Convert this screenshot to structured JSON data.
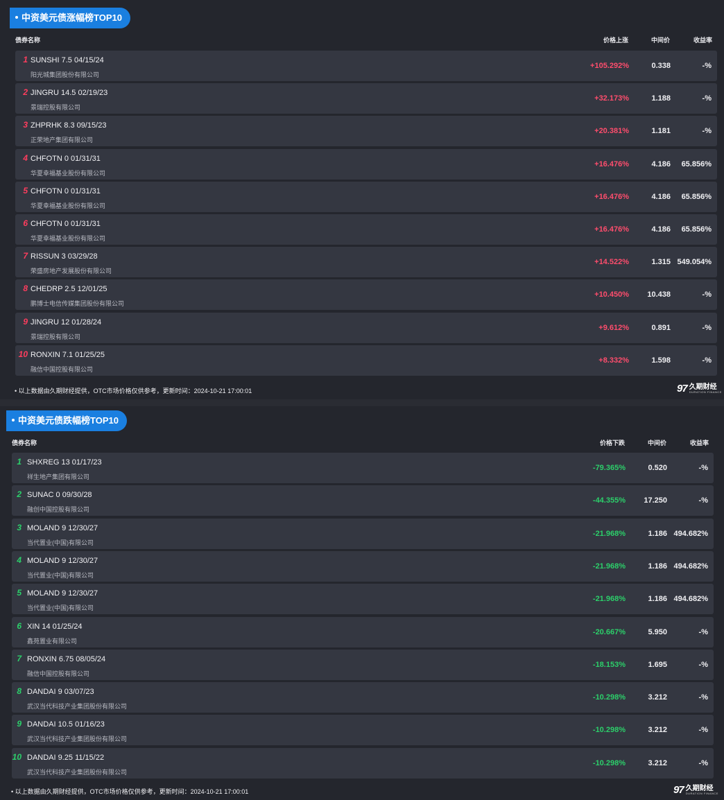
{
  "gainers": {
    "title": "中资美元债涨幅榜TOP10",
    "headers": {
      "name": "债券名称",
      "change": "价格上涨",
      "mid": "中间价",
      "yield": "收益率"
    },
    "rows": [
      {
        "rank": "1",
        "name": "SUNSHI 7.5 04/15/24",
        "issuer": "阳光城集团股份有限公司",
        "change": "+105.292%",
        "mid": "0.338",
        "yield": "-%"
      },
      {
        "rank": "2",
        "name": "JINGRU 14.5 02/19/23",
        "issuer": "景瑞控股有限公司",
        "change": "+32.173%",
        "mid": "1.188",
        "yield": "-%"
      },
      {
        "rank": "3",
        "name": "ZHPRHK 8.3 09/15/23",
        "issuer": "正荣地产集团有限公司",
        "change": "+20.381%",
        "mid": "1.181",
        "yield": "-%"
      },
      {
        "rank": "4",
        "name": "CHFOTN 0 01/31/31",
        "issuer": "华夏幸福基业股份有限公司",
        "change": "+16.476%",
        "mid": "4.186",
        "yield": "65.856%"
      },
      {
        "rank": "5",
        "name": "CHFOTN 0 01/31/31",
        "issuer": "华夏幸福基业股份有限公司",
        "change": "+16.476%",
        "mid": "4.186",
        "yield": "65.856%"
      },
      {
        "rank": "6",
        "name": "CHFOTN 0 01/31/31",
        "issuer": "华夏幸福基业股份有限公司",
        "change": "+16.476%",
        "mid": "4.186",
        "yield": "65.856%"
      },
      {
        "rank": "7",
        "name": "RISSUN 3 03/29/28",
        "issuer": "荣盛房地产发展股份有限公司",
        "change": "+14.522%",
        "mid": "1.315",
        "yield": "549.054%"
      },
      {
        "rank": "8",
        "name": "CHEDRP 2.5 12/01/25",
        "issuer": "鹏博士电信传媒集团股份有限公司",
        "change": "+10.450%",
        "mid": "10.438",
        "yield": "-%"
      },
      {
        "rank": "9",
        "name": "JINGRU 12 01/28/24",
        "issuer": "景瑞控股有限公司",
        "change": "+9.612%",
        "mid": "0.891",
        "yield": "-%"
      },
      {
        "rank": "10",
        "name": "RONXIN 7.1 01/25/25",
        "issuer": "融信中国控股有限公司",
        "change": "+8.332%",
        "mid": "1.598",
        "yield": "-%"
      }
    ],
    "footer": "• 以上数据由久期财经提供，OTC市场价格仅供参考，更新时间：2024-10-21 17:00:01"
  },
  "losers": {
    "title": "中资美元债跌幅榜TOP10",
    "headers": {
      "name": "债券名称",
      "change": "价格下跌",
      "mid": "中间价",
      "yield": "收益率"
    },
    "rows": [
      {
        "rank": "1",
        "name": "SHXREG 13 01/17/23",
        "issuer": "祥生地产集团有限公司",
        "change": "-79.365%",
        "mid": "0.520",
        "yield": "-%"
      },
      {
        "rank": "2",
        "name": "SUNAC 0 09/30/28",
        "issuer": "融创中国控股有限公司",
        "change": "-44.355%",
        "mid": "17.250",
        "yield": "-%"
      },
      {
        "rank": "3",
        "name": "MOLAND 9 12/30/27",
        "issuer": "当代置业(中国)有限公司",
        "change": "-21.968%",
        "mid": "1.186",
        "yield": "494.682%"
      },
      {
        "rank": "4",
        "name": "MOLAND 9 12/30/27",
        "issuer": "当代置业(中国)有限公司",
        "change": "-21.968%",
        "mid": "1.186",
        "yield": "494.682%"
      },
      {
        "rank": "5",
        "name": "MOLAND 9 12/30/27",
        "issuer": "当代置业(中国)有限公司",
        "change": "-21.968%",
        "mid": "1.186",
        "yield": "494.682%"
      },
      {
        "rank": "6",
        "name": "XIN 14 01/25/24",
        "issuer": "鑫苑置业有限公司",
        "change": "-20.667%",
        "mid": "5.950",
        "yield": "-%"
      },
      {
        "rank": "7",
        "name": "RONXIN 6.75 08/05/24",
        "issuer": "融信中国控股有限公司",
        "change": "-18.153%",
        "mid": "1.695",
        "yield": "-%"
      },
      {
        "rank": "8",
        "name": "DANDAI 9 03/07/23",
        "issuer": "武汉当代科技产业集团股份有限公司",
        "change": "-10.298%",
        "mid": "3.212",
        "yield": "-%"
      },
      {
        "rank": "9",
        "name": "DANDAI 10.5 01/16/23",
        "issuer": "武汉当代科技产业集团股份有限公司",
        "change": "-10.298%",
        "mid": "3.212",
        "yield": "-%"
      },
      {
        "rank": "10",
        "name": "DANDAI 9.25 11/15/22",
        "issuer": "武汉当代科技产业集团股份有限公司",
        "change": "-10.298%",
        "mid": "3.212",
        "yield": "-%"
      }
    ],
    "footer": "• 以上数据由久期财经提供，OTC市场价格仅供参考，更新时间：2024-10-21 17:00:01"
  },
  "logo": {
    "mark": "97",
    "cn": "久期财经",
    "en": "DURATION FINANCE"
  },
  "colors": {
    "up": "#ff4d6d",
    "down": "#2ccf6a",
    "badge": "#1a7fe0",
    "row": "#343741"
  }
}
